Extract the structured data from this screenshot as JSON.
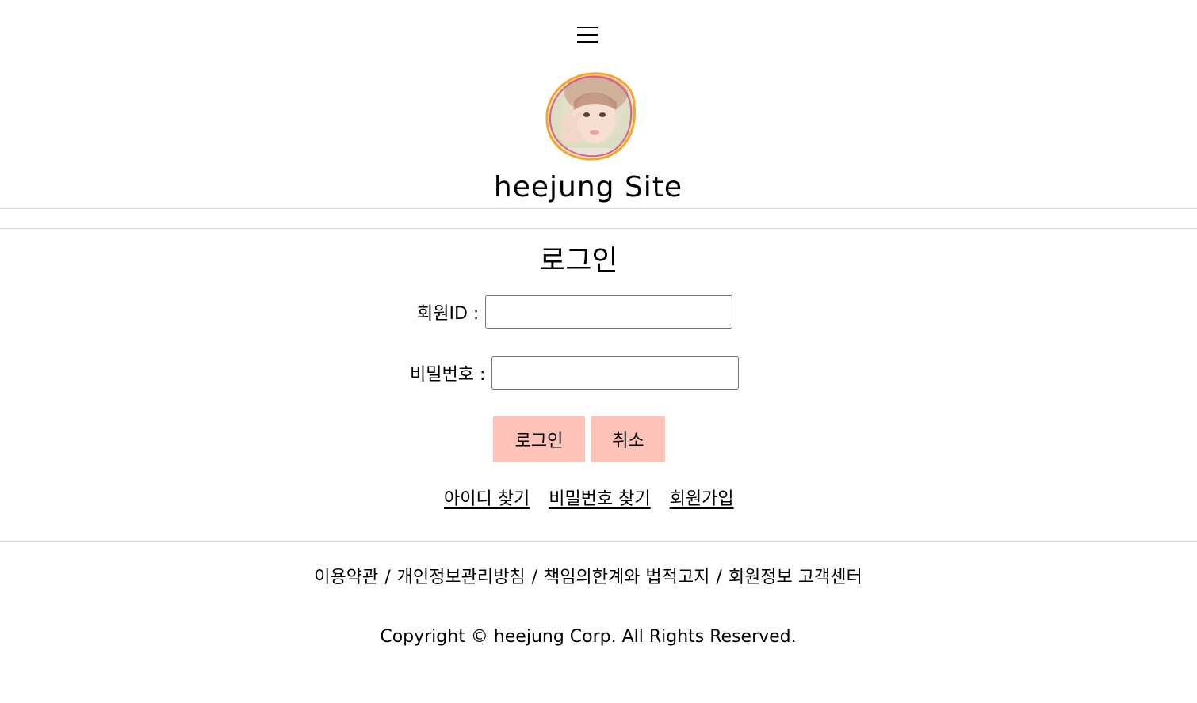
{
  "header": {
    "menu_icon": "hamburger-menu-icon",
    "avatar_icon": "profile-avatar-image",
    "site_title": "heejung Site"
  },
  "login": {
    "title": "로그인",
    "id_label": "회원ID :",
    "id_value": "",
    "password_label": "비밀번호 :",
    "password_value": "",
    "login_button": "로그인",
    "cancel_button": "취소",
    "find_id_link": "아이디 찾기",
    "find_password_link": "비밀번호 찾기",
    "signup_link": "회원가입"
  },
  "footer": {
    "links": [
      "이용약관",
      "개인정보관리방침",
      "책임의한계와 법적고지",
      "회원정보 고객센터"
    ],
    "separator": "/",
    "copyright": "Copyright © heejung Corp. All Rights Reserved."
  },
  "colors": {
    "button_bg": "#ffc2b8",
    "divider": "#d6d6d6",
    "avatar_ring_orange": "#f5a623",
    "avatar_ring_pink": "#e8457a"
  }
}
